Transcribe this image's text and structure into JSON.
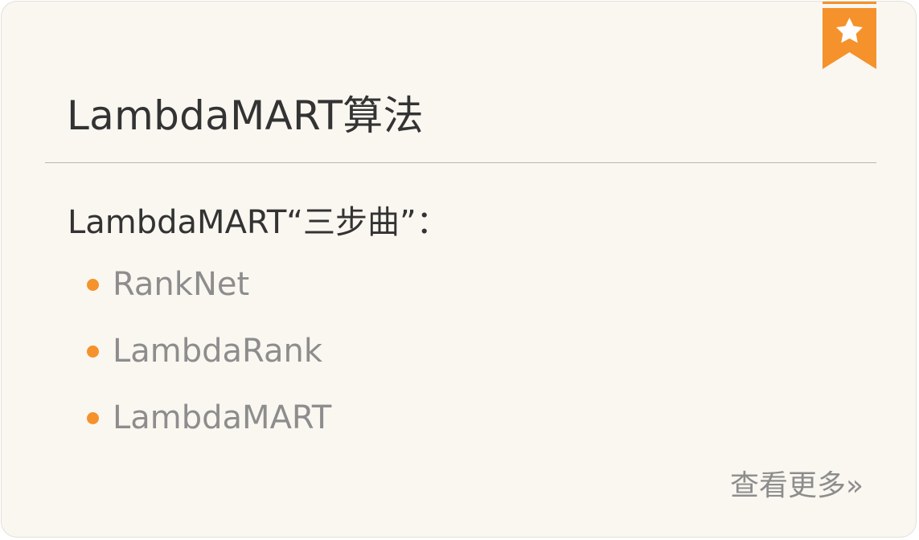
{
  "card": {
    "title": "LambdaMART算法",
    "subtitle": "LambdaMART“三步曲”：",
    "items": [
      {
        "label": "RankNet"
      },
      {
        "label": "LambdaRank"
      },
      {
        "label": "LambdaMART"
      }
    ],
    "more_link": "查看更多»",
    "bookmark_icon": "star-bookmark-icon"
  },
  "colors": {
    "card_background": "#faf7f1",
    "accent_orange": "#f5922c",
    "title_text": "#333333",
    "muted_text": "#8d8d8d",
    "divider": "#b9b6b2"
  }
}
